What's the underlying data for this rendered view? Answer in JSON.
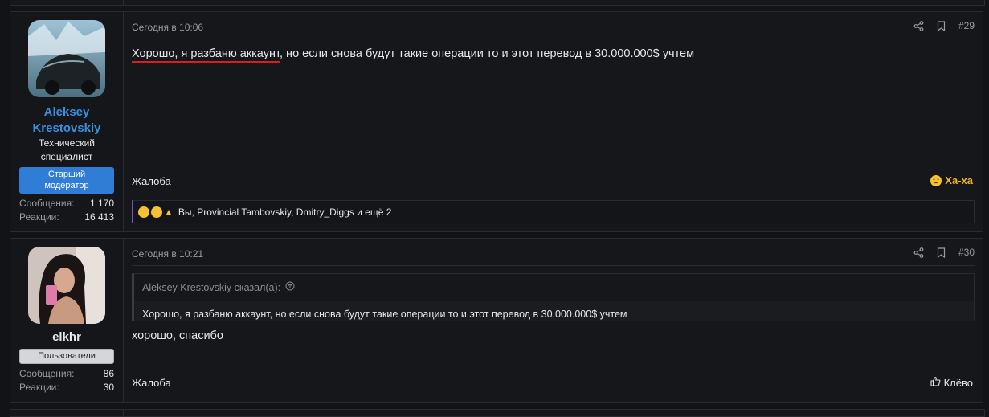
{
  "posts": [
    {
      "username": "Aleksey Krestovskiy",
      "username_color": "#3b8fe0",
      "user_title_line1": "Технический",
      "user_title_line2": "специалист",
      "banner": "Старший модератор",
      "banner_color": "#2f7dd4",
      "stats": [
        {
          "label": "Сообщения:",
          "value": "1 170"
        },
        {
          "label": "Реакции:",
          "value": "16 413"
        }
      ],
      "date": "Сегодня в 10:06",
      "number": "#29",
      "message_underlined": "Хорошо, я разбаню аккаунт",
      "message_rest": ", но если снова будут такие операции то и этот перевод в 30.000.000$ учтем",
      "report": "Жалоба",
      "reaction_label": "Ха-ха",
      "reaction_color": "#f0b429",
      "reactions_text": "Вы, Provincial Tambovskiy, Dmitry_Diggs и ещё 2"
    },
    {
      "username": "elkhr",
      "username_color": "#e6e7ea",
      "banner": "Пользователи",
      "banner_color": "#d4d6da",
      "stats": [
        {
          "label": "Сообщения:",
          "value": "86"
        },
        {
          "label": "Реакции:",
          "value": "30"
        }
      ],
      "date": "Сегодня в 10:21",
      "number": "#30",
      "quote_author": "Aleksey Krestovskiy сказал(а):",
      "quote_text": "Хорошо, я разбаню аккаунт, но если снова будут такие операции то и этот перевод в 30.000.000$ учтем",
      "message": "хорошо, спасибо",
      "report": "Жалоба",
      "like_label": "Клёво"
    }
  ],
  "icons": [
    "share-icon",
    "bookmark-icon",
    "laugh-emoji-icon",
    "thumbs-up-icon",
    "arrow-up-circle-icon"
  ]
}
